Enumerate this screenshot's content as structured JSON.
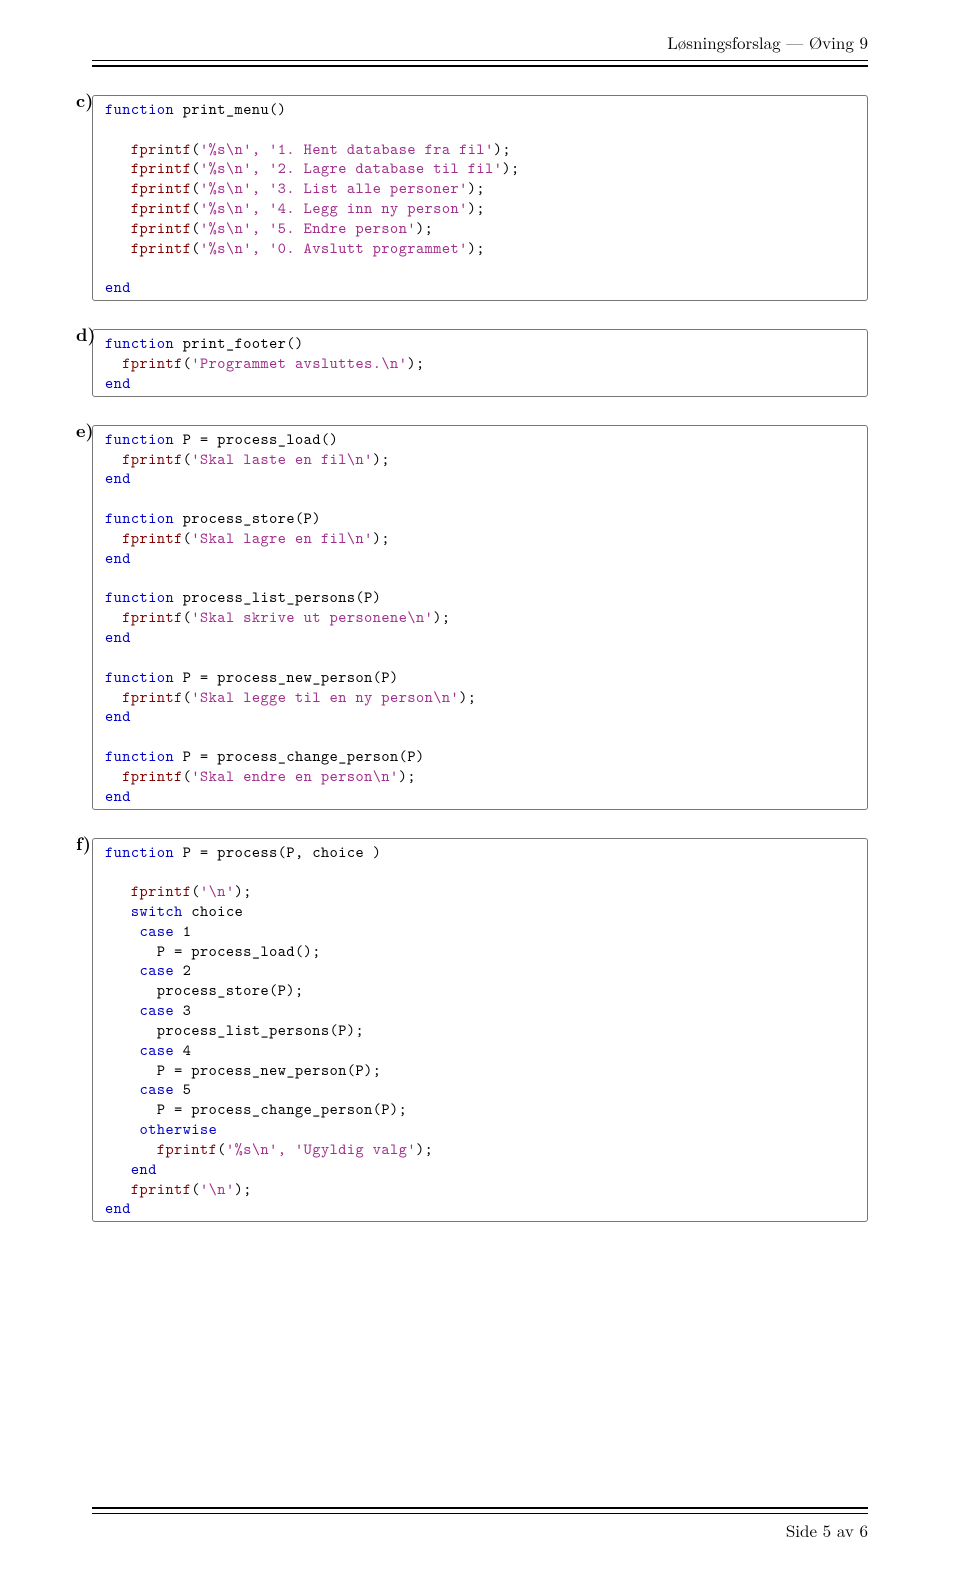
{
  "header": {
    "title": "Løsningsforslag — Øving 9"
  },
  "footer": {
    "text": "Side 5 av 6"
  },
  "labels": {
    "c": "c)",
    "d": "d)",
    "e": "e)",
    "f": "f)"
  },
  "tokens": {
    "function": "function",
    "end": "end",
    "switch": "switch",
    "case": "case",
    "otherwise": "otherwise",
    "fprintf": "fprintf"
  },
  "code_c": {
    "sig": "print_menu()",
    "s1": "'%s\\n', '1. Hent database fra fil'",
    "s2": "'%s\\n', '2. Lagre database til fil'",
    "s3": "'%s\\n', '3. List alle personer'",
    "s4": "'%s\\n', '4. Legg inn ny person'",
    "s5": "'%s\\n', '5. Endre person'",
    "s6": "'%s\\n', '0. Avslutt programmet'"
  },
  "code_d": {
    "sig": "print_footer()",
    "s1": "'Programmet avsluttes.\\n'"
  },
  "code_e": {
    "sig1": "P = process_load()",
    "s1": "'Skal laste en fil\\n'",
    "sig2": "process_store(P)",
    "s2": "'Skal lagre en fil\\n'",
    "sig3": "process_list_persons(P)",
    "s3": "'Skal skrive ut personene\\n'",
    "sig4": "P = process_new_person(P)",
    "s4": "'Skal legge til en ny person\\n'",
    "sig5": "P = process_change_person(P)",
    "s5": "'Skal endre en person\\n'"
  },
  "code_f": {
    "sig": "P = process(P, choice )",
    "s_nl1": "'\\n'",
    "switch_expr": " choice",
    "c1": " 1",
    "l1": "      P = process_load();",
    "c2": " 2",
    "l2": "      process_store(P);",
    "c3": " 3",
    "l3": "      process_list_persons(P);",
    "c4": " 4",
    "l4": "      P = process_new_person(P);",
    "c5": " 5",
    "l5": "      P = process_change_person(P);",
    "s_err": "'%s\\n', 'Ugyldig valg'",
    "s_nl2": "'\\n'"
  }
}
